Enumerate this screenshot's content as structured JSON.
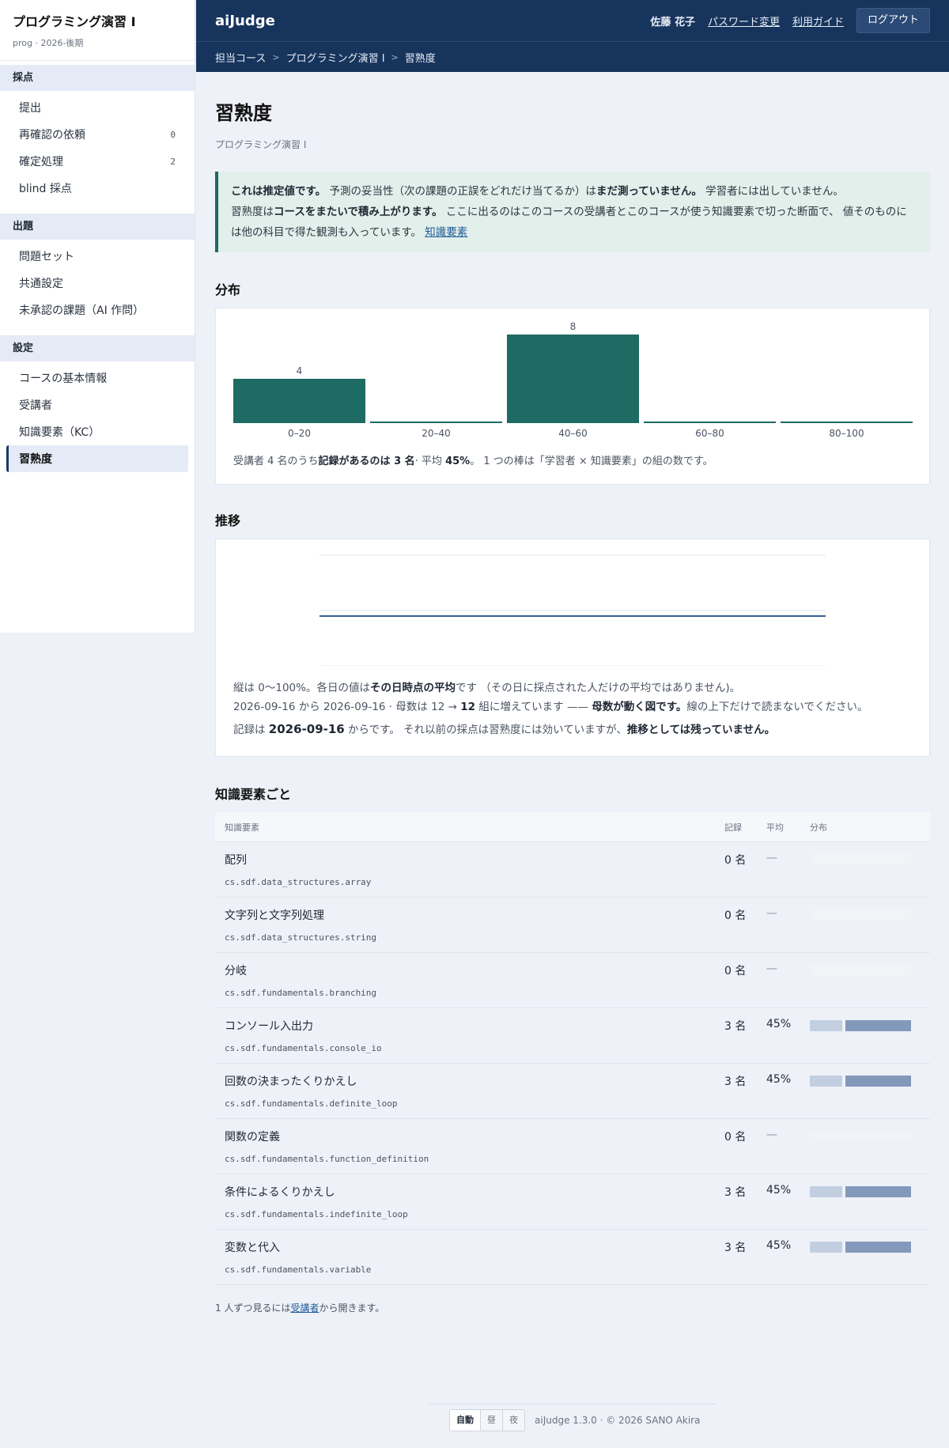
{
  "sidebar": {
    "course_title": "プログラミング演習 I",
    "course_sub": "prog · 2026-後期",
    "groups": [
      {
        "title": "採点",
        "items": [
          {
            "label": "提出",
            "count": ""
          },
          {
            "label": "再確認の依頼",
            "count": "0"
          },
          {
            "label": "確定処理",
            "count": "2"
          },
          {
            "label": "blind 採点",
            "count": ""
          }
        ]
      },
      {
        "title": "出題",
        "items": [
          {
            "label": "問題セット"
          },
          {
            "label": "共通設定"
          },
          {
            "label": "未承認の課題（AI 作問）"
          }
        ]
      },
      {
        "title": "設定",
        "items": [
          {
            "label": "コースの基本情報"
          },
          {
            "label": "受講者"
          },
          {
            "label": "知識要素（KC）"
          },
          {
            "label": "習熟度"
          }
        ]
      }
    ]
  },
  "header": {
    "brand": "aiJudge",
    "user": "佐藤 花子",
    "password_link": "パスワード変更",
    "guide_link": "利用ガイド",
    "logout": "ログアウト"
  },
  "breadcrumb": {
    "items": [
      "担当コース",
      "プログラミング演習 I",
      "習熟度"
    ],
    "sep": ">"
  },
  "page": {
    "title": "習熟度",
    "subtitle": "プログラミング演習 I"
  },
  "notice": {
    "b1": "これは推定値です。",
    "t1": " 予測の妥当性（次の課題の正誤をどれだけ当てるか）は",
    "b2": "まだ測っていません。",
    "t2": " 学習者には出していません。",
    "t3": "習熟度は",
    "b3": "コースをまたいで積み上がります。",
    "t4": " ここに出るのはこのコースの受講者とこのコースが使う知識要素で切った断面で、 値そのものには他の科目で得た観測も入っています。 ",
    "link": "知識要素"
  },
  "distribution": {
    "title": "分布",
    "note_pre": "受講者 4 名のうち",
    "note_bold1": "記録があるのは 3 名",
    "note_mid": "· 平均 ",
    "note_bold2": "45%",
    "note_post": "。 1 つの棒は「学習者 × 知識要素」の組の数です。"
  },
  "trend": {
    "title": "推移",
    "l1_pre": "縦は 0〜100%。各日の値は",
    "l1_bold": "その日時点の平均",
    "l1_post": "です （その日に採点された人だけの平均ではありません)。",
    "l2_pre": "2026-09-16 から 2026-09-16 · 母数は 12 → ",
    "l2_bold1": "12",
    "l2_mid": " 組に増えています —— ",
    "l2_bold2": "母数が動く図です。",
    "l2_post": "線の上下だけで読まないでください。",
    "l3_pre": "記録は ",
    "l3_bold1": "2026-09-16",
    "l3_mid": " からです。 それ以前の採点は習熟度には効いていますが、",
    "l3_bold2": "推移としては残っていません。"
  },
  "chart_data": [
    {
      "type": "bar",
      "categories": [
        "0–20",
        "20–40",
        "40–60",
        "60–80",
        "80–100"
      ],
      "values": [
        4,
        0,
        8,
        0,
        0
      ],
      "ylim": [
        0,
        8
      ],
      "color": "#1e6b63"
    },
    {
      "type": "line",
      "x": [
        "2026-09-16",
        "2026-09-16"
      ],
      "y": [
        45,
        45
      ],
      "ylim": [
        0,
        100
      ],
      "grid": true,
      "color": "#3a5f93"
    }
  ],
  "kc": {
    "title": "知識要素ごと",
    "headers": {
      "name": "知識要素",
      "records": "記録",
      "avg": "平均",
      "dist": "分布"
    },
    "rows": [
      {
        "name": "配列",
        "id": "cs.sdf.data_structures.array",
        "records": "0 名",
        "avg": "—",
        "dist": []
      },
      {
        "name": "文字列と文字列処理",
        "id": "cs.sdf.data_structures.string",
        "records": "0 名",
        "avg": "—",
        "dist": []
      },
      {
        "name": "分岐",
        "id": "cs.sdf.fundamentals.branching",
        "records": "0 名",
        "avg": "—",
        "dist": []
      },
      {
        "name": "コンソール入出力",
        "id": "cs.sdf.fundamentals.console_io",
        "records": "3 名",
        "avg": "45%",
        "dist": [
          0.33,
          0.67
        ]
      },
      {
        "name": "回数の決まったくりかえし",
        "id": "cs.sdf.fundamentals.definite_loop",
        "records": "3 名",
        "avg": "45%",
        "dist": [
          0.33,
          0.67
        ]
      },
      {
        "name": "関数の定義",
        "id": "cs.sdf.fundamentals.function_definition",
        "records": "0 名",
        "avg": "—",
        "dist": []
      },
      {
        "name": "条件によるくりかえし",
        "id": "cs.sdf.fundamentals.indefinite_loop",
        "records": "3 名",
        "avg": "45%",
        "dist": [
          0.33,
          0.67
        ]
      },
      {
        "name": "変数と代入",
        "id": "cs.sdf.fundamentals.variable",
        "records": "3 名",
        "avg": "45%",
        "dist": [
          0.33,
          0.67
        ]
      }
    ],
    "note_pre": "1 人ずつ見るには",
    "note_link": "受講者",
    "note_post": "から開きます。"
  },
  "footer": {
    "themes": [
      "自動",
      "昼",
      "夜"
    ],
    "active_theme": "自動",
    "copy": "aiJudge 1.3.0 · © 2026 SANO Akira"
  }
}
